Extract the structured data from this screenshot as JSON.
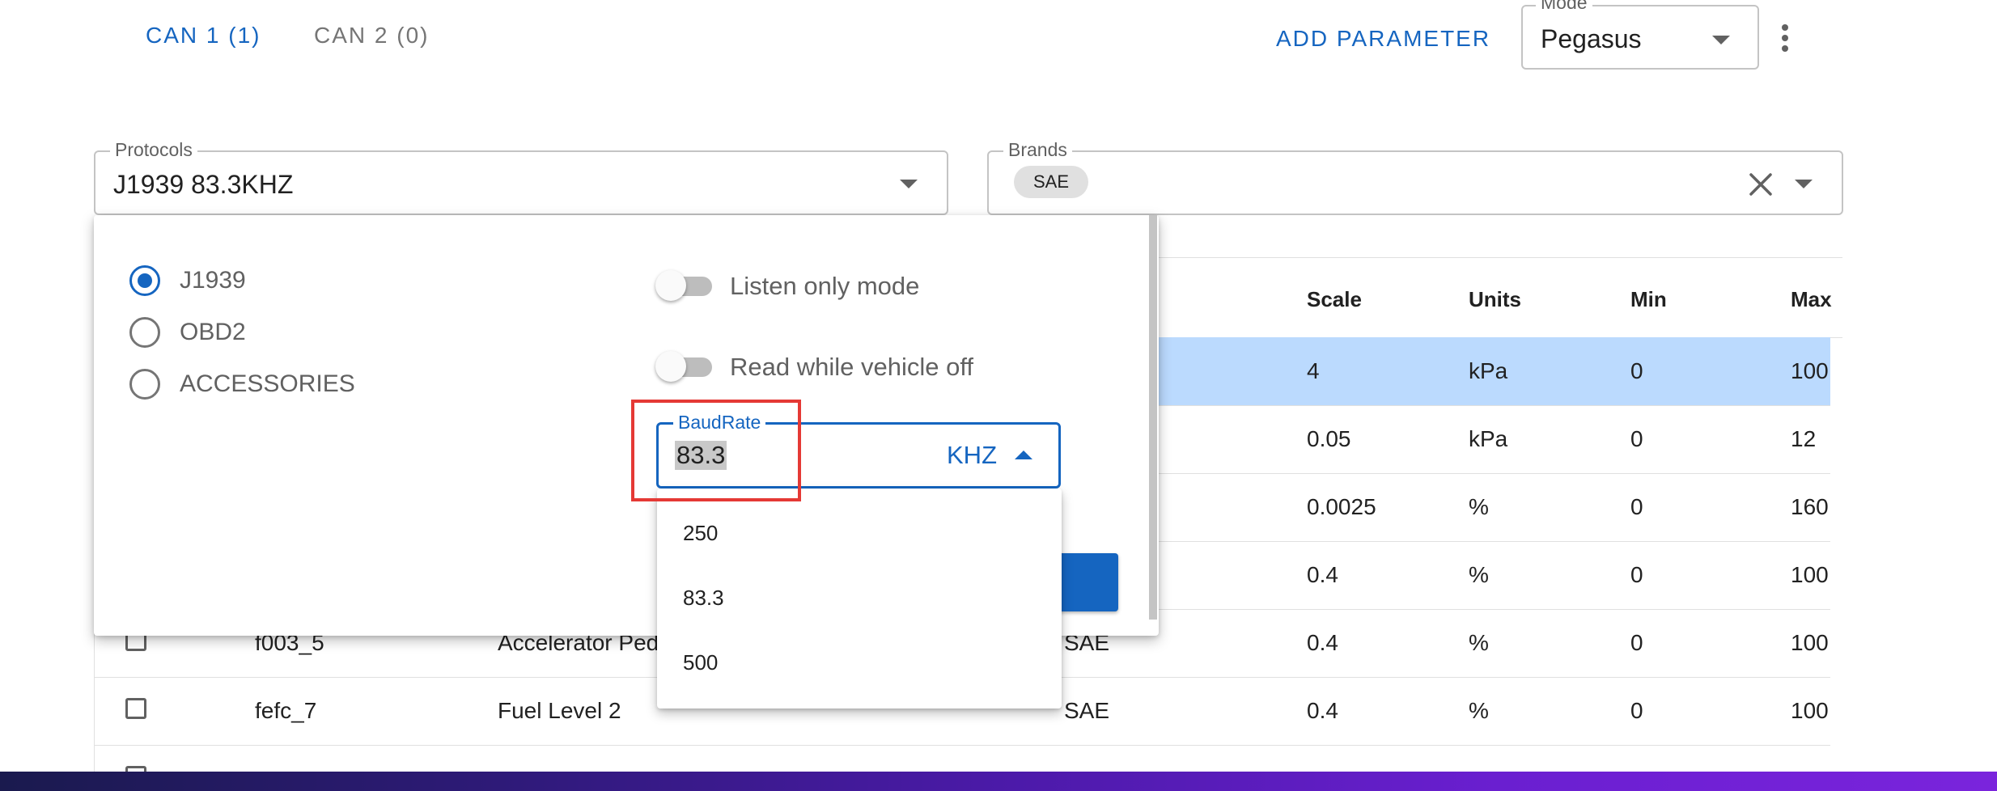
{
  "tabs": [
    {
      "label": "CAN 1 (1)",
      "active": true
    },
    {
      "label": "CAN 2 (0)",
      "active": false
    }
  ],
  "header": {
    "add_parameter": "ADD PARAMETER",
    "mode": {
      "label": "Mode",
      "value": "Pegasus"
    }
  },
  "protocols": {
    "label": "Protocols",
    "value": "J1939 83.3KHZ"
  },
  "brands": {
    "label": "Brands",
    "chips": [
      "SAE"
    ]
  },
  "table": {
    "headers": [
      "Scale",
      "Units",
      "Min",
      "Max"
    ],
    "rows": [
      {
        "id": "",
        "name": "",
        "brand": "",
        "scale": "4",
        "units": "kPa",
        "min": "0",
        "max": "100",
        "selected": true
      },
      {
        "id": "",
        "name": "",
        "brand": "",
        "scale": "0.05",
        "units": "kPa",
        "min": "0",
        "max": "12",
        "selected": false
      },
      {
        "id": "",
        "name": "",
        "brand": "",
        "scale": "0.0025",
        "units": "%",
        "min": "0",
        "max": "160",
        "selected": false
      },
      {
        "id": "",
        "name": "",
        "brand": "",
        "scale": "0.4",
        "units": "%",
        "min": "0",
        "max": "100",
        "selected": false
      },
      {
        "id": "f003_5",
        "name": "Accelerator Ped",
        "brand": "SAE",
        "scale": "0.4",
        "units": "%",
        "min": "0",
        "max": "100",
        "selected": false
      },
      {
        "id": "fefc_7",
        "name": "Fuel Level 2",
        "brand": "SAE",
        "scale": "0.4",
        "units": "%",
        "min": "0",
        "max": "100",
        "selected": false
      }
    ]
  },
  "panel": {
    "protocol_options": [
      {
        "label": "J1939",
        "checked": true
      },
      {
        "label": "OBD2",
        "checked": false
      },
      {
        "label": "ACCESSORIES",
        "checked": false
      }
    ],
    "switches": [
      {
        "label": "Listen only mode",
        "on": false
      },
      {
        "label": "Read while vehicle off",
        "on": false
      }
    ],
    "baudrate": {
      "label": "BaudRate",
      "value": "83.3",
      "unit": "KHZ",
      "options": [
        "250",
        "83.3",
        "500"
      ]
    }
  },
  "colors": {
    "accent": "#1565c0",
    "selected_row": "#bbdafe",
    "highlight": "#e53935"
  },
  "icons": {
    "clear": "close-icon",
    "dropdown": "chevron-down-icon",
    "menu": "kebab-icon"
  }
}
